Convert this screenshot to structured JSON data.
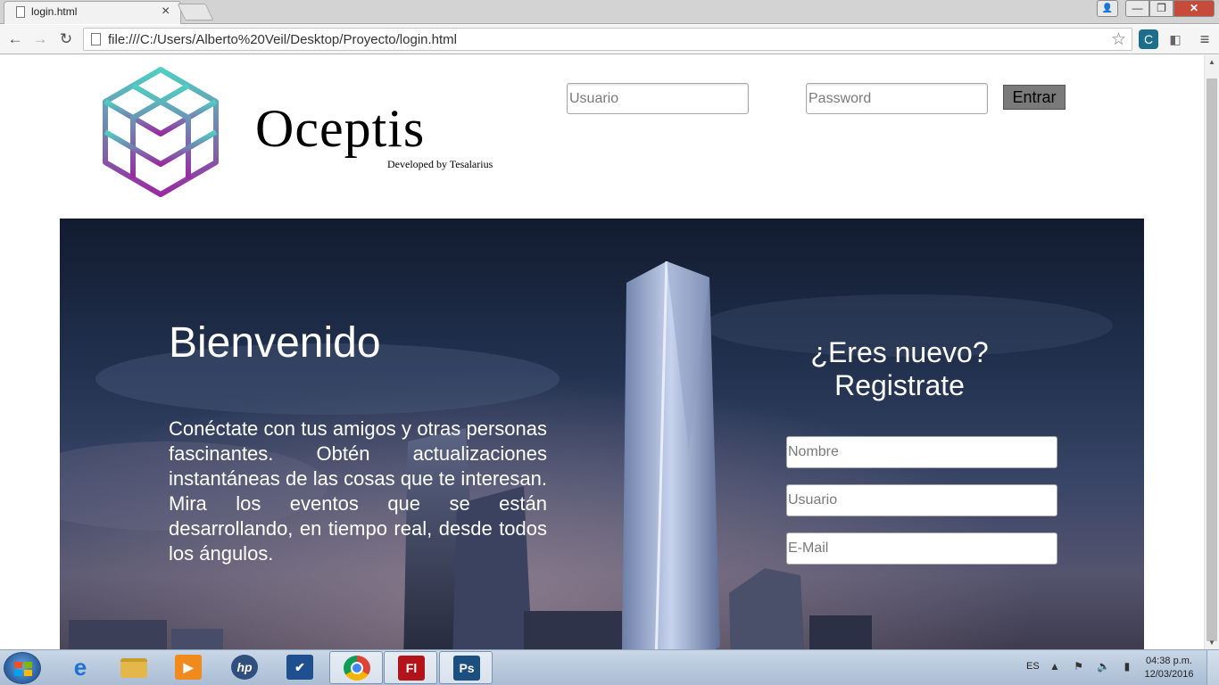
{
  "browser": {
    "tab_title": "login.html",
    "tab_close": "×",
    "url": "file:///C:/Users/Alberto%20Veil/Desktop/Proyecto/login.html",
    "back": "←",
    "forward": "→",
    "reload": "↻",
    "star": "☆",
    "menu": "≡",
    "window_user": "👤",
    "window_min": "—",
    "window_max": "❐",
    "window_close": "✕"
  },
  "header": {
    "brand_name": "Oceptis",
    "brand_subtitle": "Developed by Tesalarius",
    "login": {
      "username_placeholder": "Usuario",
      "password_placeholder": "Password",
      "submit_label": "Entrar"
    }
  },
  "hero": {
    "welcome_title": "Bienvenido",
    "welcome_text": "Conéctate con tus amigos y otras personas fascinantes. Obtén actualizaciones instantáneas de las cosas que te interesan. Mira los eventos que se están desarrollando, en tiempo real, desde todos los ángulos.",
    "register": {
      "title_line1": "¿Eres nuevo?",
      "title_line2": "Registrate",
      "name_placeholder": "Nombre",
      "username_placeholder": "Usuario",
      "email_placeholder": "E-Mail"
    }
  },
  "taskbar": {
    "items": [
      {
        "name": "internet-explorer-icon",
        "label": "e",
        "color": "#1e73d2"
      },
      {
        "name": "file-explorer-icon",
        "label": "",
        "color": "#e3b74a"
      },
      {
        "name": "media-player-icon",
        "label": "▶",
        "color": "#f08a1c"
      },
      {
        "name": "hp-icon",
        "label": "hp",
        "color": "#2f4f7f"
      },
      {
        "name": "check-app-icon",
        "label": "✔",
        "color": "#1e4f8f"
      },
      {
        "name": "chrome-icon",
        "label": "",
        "color": "#ffffff"
      },
      {
        "name": "flash-icon",
        "label": "Fl",
        "color": "#b3141a"
      },
      {
        "name": "photoshop-icon",
        "label": "Ps",
        "color": "#1b4f80"
      }
    ],
    "language": "ES",
    "tray_icons": "▲ ⚑ 🔈 ▮",
    "time": "04:38 p.m.",
    "date": "12/03/2016"
  },
  "colors": {
    "logo_top": "#4fd0c2",
    "logo_bottom": "#9a2aa0",
    "login_button": "#7a7a7a",
    "window_close": "#c74b3b"
  }
}
